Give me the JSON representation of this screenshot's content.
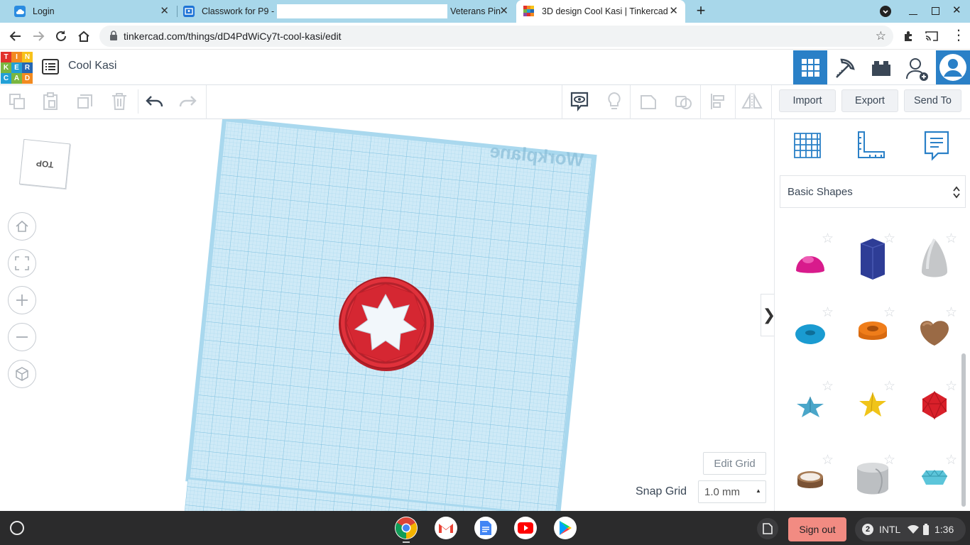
{
  "browser": {
    "tabs": [
      {
        "title": "Login",
        "active": false
      },
      {
        "title": "Classwork for P9 -",
        "title_suffix": "Veterans Pin",
        "active": false
      },
      {
        "title": "3D design Cool Kasi | Tinkercad",
        "active": true
      }
    ],
    "url": "tinkercad.com/things/dD4PdWiCy7t-cool-kasi/edit"
  },
  "app": {
    "logo_letters": [
      "T",
      "I",
      "N",
      "K",
      "E",
      "R",
      "C",
      "A",
      "D"
    ],
    "design_name": "Cool Kasi",
    "toolbar": {
      "import_label": "Import",
      "export_label": "Export",
      "send_to_label": "Send To"
    },
    "viewcube_label": "TOP",
    "workplane_label": "Workplane",
    "edit_grid_label": "Edit Grid",
    "snap_grid_label": "Snap Grid",
    "snap_grid_value": "1.0 mm",
    "shape_category": "Basic Shapes",
    "shapes": [
      {
        "name": "half-sphere",
        "color": "#d81b8c"
      },
      {
        "name": "polygon",
        "color": "#2e3d96"
      },
      {
        "name": "paraboloid",
        "color": "#c5c7c9"
      },
      {
        "name": "torus",
        "color": "#1a9bd1"
      },
      {
        "name": "tube",
        "color": "#ef7d1a"
      },
      {
        "name": "heart",
        "color": "#9a6a45"
      },
      {
        "name": "star",
        "color": "#4aa6c9"
      },
      {
        "name": "star-gold",
        "color": "#f0c419"
      },
      {
        "name": "icosahedron",
        "color": "#d9202a"
      },
      {
        "name": "ring",
        "color": "#8d6240"
      },
      {
        "name": "round-roof",
        "color": "#bcbfc2"
      },
      {
        "name": "gem",
        "color": "#5cc5da"
      }
    ],
    "accent_color": "#2a80c7"
  },
  "shelf": {
    "sign_out_label": "Sign out",
    "notification_count": "2",
    "keyboard_layout": "INTL",
    "time": "1:36"
  }
}
